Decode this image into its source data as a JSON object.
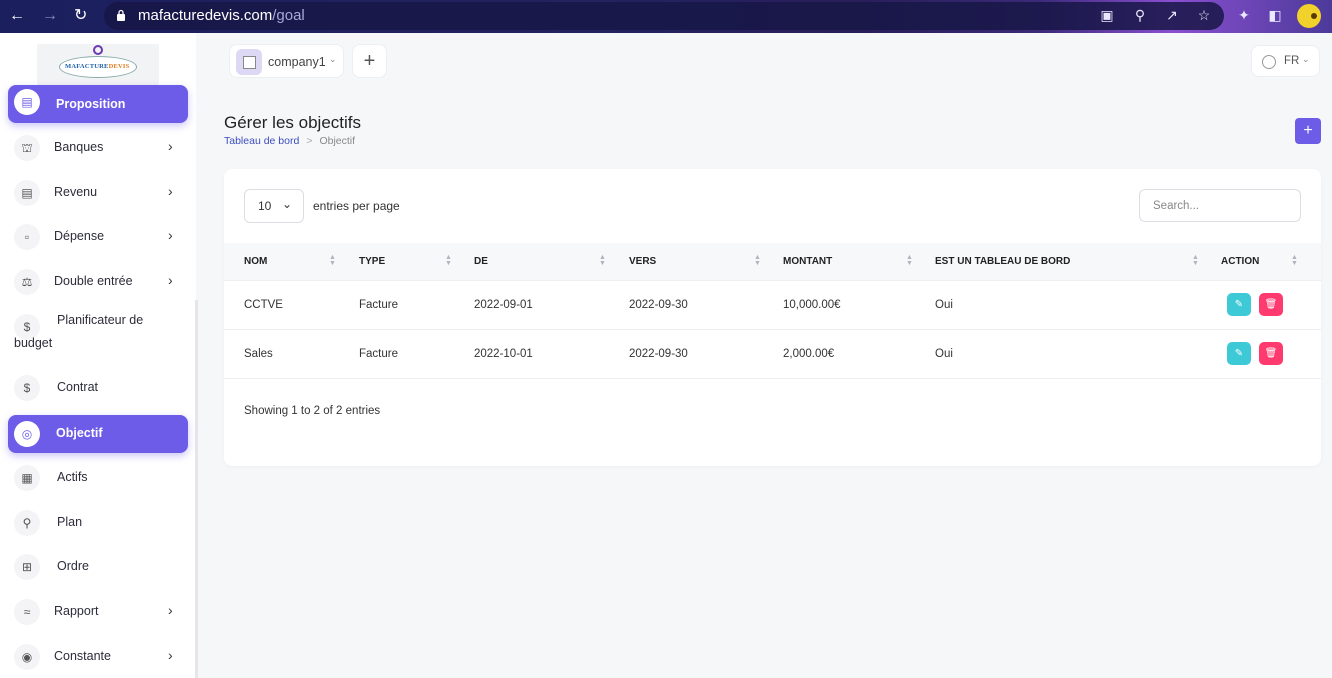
{
  "browser": {
    "url_host": "mafacturedevis.com",
    "url_path": "/goal"
  },
  "brand": {
    "logo_text_main": "MAFACTURE",
    "logo_text_accent": "DEVIS",
    "accent_color": "#6c5ce7"
  },
  "sidebar": {
    "items": [
      {
        "label": "Proposition",
        "icon": "document-icon",
        "active": true
      },
      {
        "label": "Banques",
        "icon": "bank-icon",
        "chevron": true
      },
      {
        "label": "Revenu",
        "icon": "invoice-icon",
        "chevron": true
      },
      {
        "label": "Dépense",
        "icon": "clipboard-icon",
        "chevron": true
      },
      {
        "label": "Double entrée",
        "icon": "scale-icon",
        "chevron": true
      },
      {
        "label": "Planificateur de",
        "label2": "budget",
        "icon": "budget-icon"
      },
      {
        "label": "Contrat",
        "icon": "contract-icon"
      },
      {
        "label": "Objectif",
        "icon": "target-icon",
        "active": true
      },
      {
        "label": "Actifs",
        "icon": "calculator-icon"
      },
      {
        "label": "Plan",
        "icon": "trophy-icon"
      },
      {
        "label": "Ordre",
        "icon": "cart-icon"
      },
      {
        "label": "Rapport",
        "icon": "chart-line-icon",
        "chevron": true
      },
      {
        "label": "Constante",
        "icon": "settings-icon",
        "chevron": true
      }
    ]
  },
  "topbar": {
    "company_name": "company1",
    "add_label": "+",
    "language": "FR"
  },
  "header": {
    "title": "Gérer les objectifs",
    "breadcrumb_home": "Tableau de bord",
    "breadcrumb_current": "Objectif",
    "add_button": "+"
  },
  "table": {
    "per_page_value": "10",
    "per_page_label": "entries per page",
    "search_placeholder": "Search...",
    "columns": [
      "NOM",
      "TYPE",
      "DE",
      "VERS",
      "MONTANT",
      "EST UN TABLEAU DE BORD",
      "ACTION"
    ],
    "rows": [
      {
        "nom": "CCTVE",
        "type": "Facture",
        "de": "2022-09-01",
        "vers": "2022-09-30",
        "montant": "10,000.00€",
        "dashboard": "Oui"
      },
      {
        "nom": "Sales",
        "type": "Facture",
        "de": "2022-10-01",
        "vers": "2022-09-30",
        "montant": "2,000.00€",
        "dashboard": "Oui"
      }
    ],
    "footer": "Showing 1 to 2 of 2 entries"
  }
}
